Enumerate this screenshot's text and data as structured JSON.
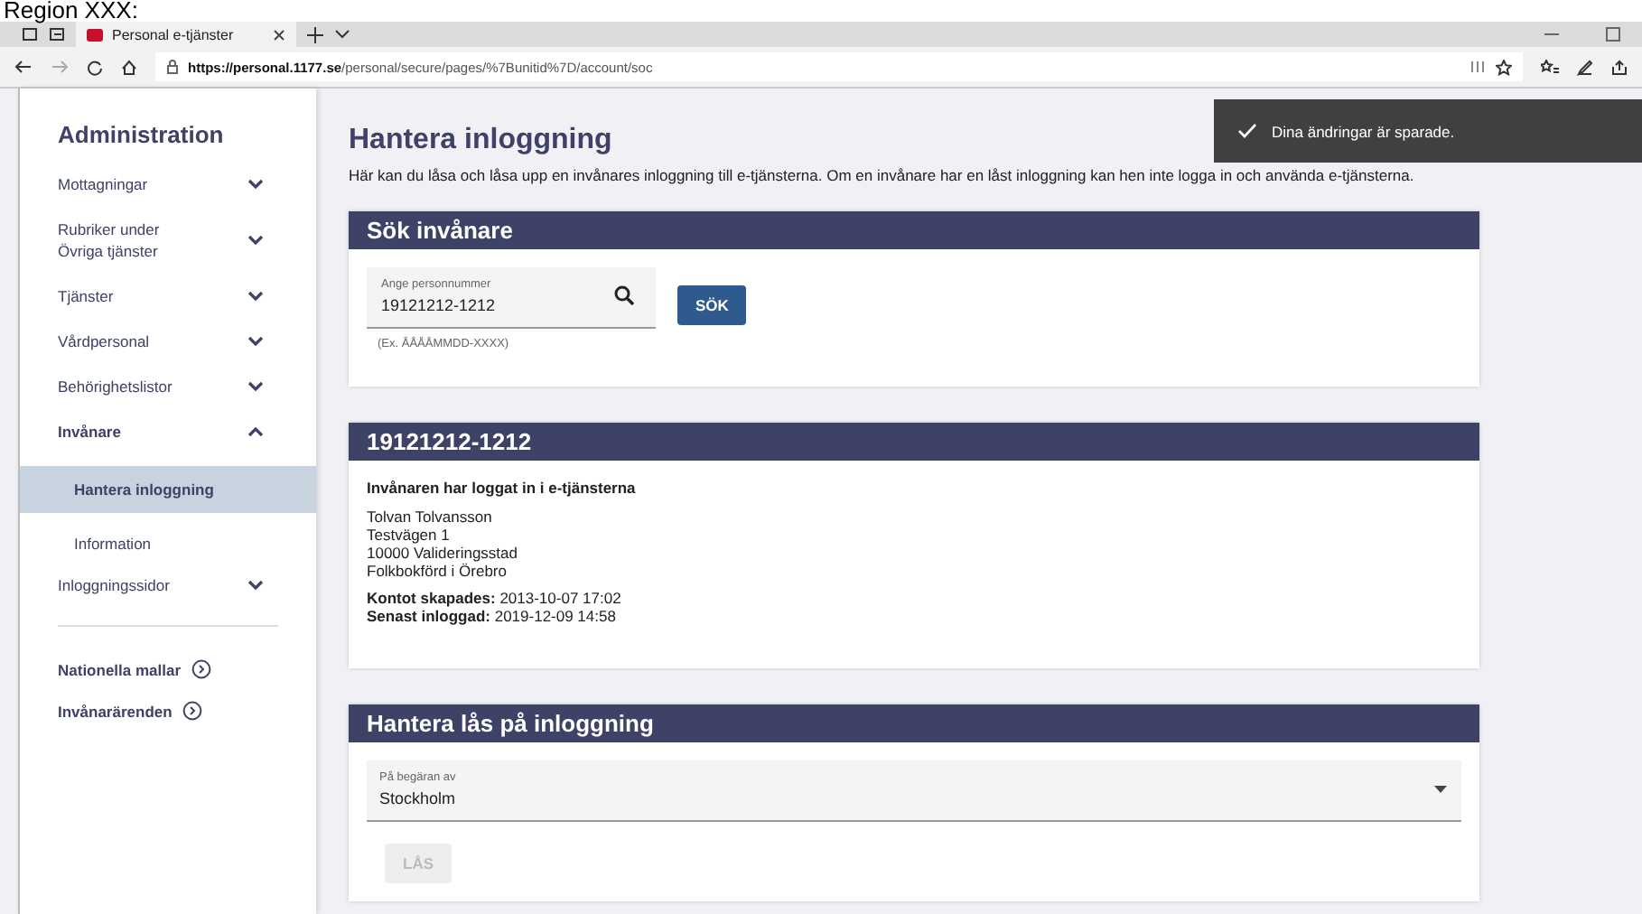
{
  "caption": "Region XXX:",
  "browser": {
    "tab_title": "Personal e-tjänster",
    "url_host": "https://personal.1177.se",
    "url_path": "/personal/secure/pages/%7Bunitid%7D/account/soc"
  },
  "sidebar": {
    "title": "Administration",
    "items": [
      {
        "label": "Mottagningar",
        "expanded": false
      },
      {
        "label": "Rubriker under Övriga tjänster",
        "expanded": false
      },
      {
        "label": "Tjänster",
        "expanded": false
      },
      {
        "label": "Vårdpersonal",
        "expanded": false
      },
      {
        "label": "Behörighetslistor",
        "expanded": false
      },
      {
        "label": "Invånare",
        "expanded": true,
        "children": [
          {
            "label": "Hantera inloggning",
            "selected": true
          },
          {
            "label": "Information",
            "selected": false
          }
        ]
      },
      {
        "label": "Inloggningssidor",
        "expanded": false
      }
    ],
    "links": [
      "Nationella mallar",
      "Invånarärenden"
    ]
  },
  "page": {
    "title": "Hantera inloggning",
    "intro": "Här kan du låsa och låsa upp en invånares inloggning till e-tjänsterna. Om en invånare har en låst inloggning kan hen inte logga in och använda e-tjänsterna.",
    "toast": "Dina ändringar är sparade.",
    "search": {
      "title": "Sök invånare",
      "field_label": "Ange personnummer",
      "field_value": "19121212-1212",
      "hint": "(Ex. ÅÅÅÅMMDD-XXXX)",
      "button": "SÖK"
    },
    "resident": {
      "title": "19121212-1212",
      "status": "Invånaren har loggat in i e-tjänsterna",
      "address": [
        "Tolvan Tolvansson",
        "Testvägen 1",
        "10000 Valideringsstad",
        "Folkbokförd i Örebro"
      ],
      "facts": [
        {
          "label": "Kontot skapades:",
          "value": "2013-10-07 17:02"
        },
        {
          "label": "Senast inloggad:",
          "value": "2019-12-09 14:58"
        }
      ]
    },
    "lock": {
      "title": "Hantera lås på inloggning",
      "select_label": "På begäran av",
      "select_value": "Stockholm",
      "button": {
        "label": "LÅS",
        "disabled": true
      }
    }
  }
}
